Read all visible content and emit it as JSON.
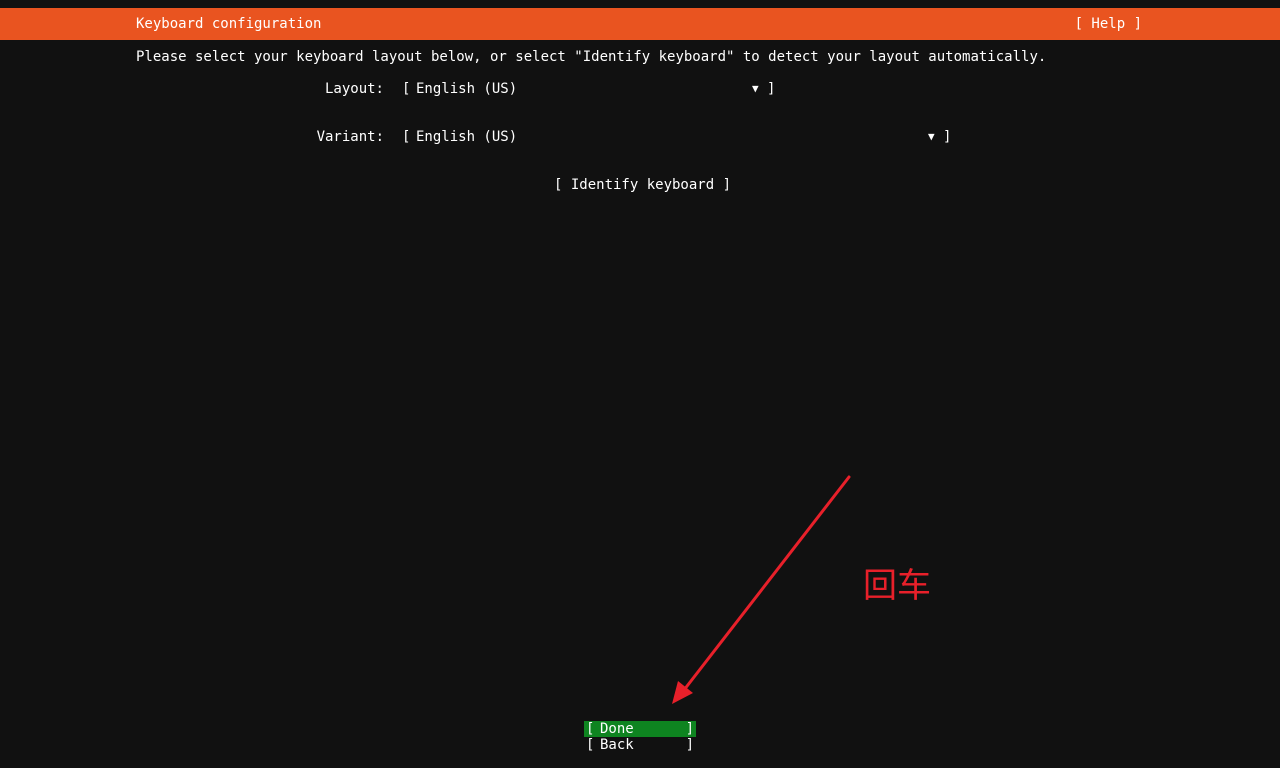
{
  "header": {
    "title": "Keyboard configuration",
    "help": "[ Help ]"
  },
  "instructions": "Please select your keyboard layout below, or select \"Identify keyboard\" to detect your layout automatically.",
  "form": {
    "layout": {
      "label": "Layout:",
      "value": "English (US)"
    },
    "variant": {
      "label": "Variant:",
      "value": "English (US)"
    },
    "bracket_open": "[",
    "bracket_close": "]",
    "arrow": "▼"
  },
  "identify_button": "[ Identify keyboard ]",
  "buttons": {
    "done": "Done",
    "back": "Back",
    "open": "[",
    "close": "]"
  },
  "annotation": {
    "text": "回车",
    "color": "#e8202a"
  },
  "colors": {
    "header_bg": "#e95420",
    "focus_bg": "#0e8420",
    "background": "#111111",
    "text": "#ffffff"
  }
}
